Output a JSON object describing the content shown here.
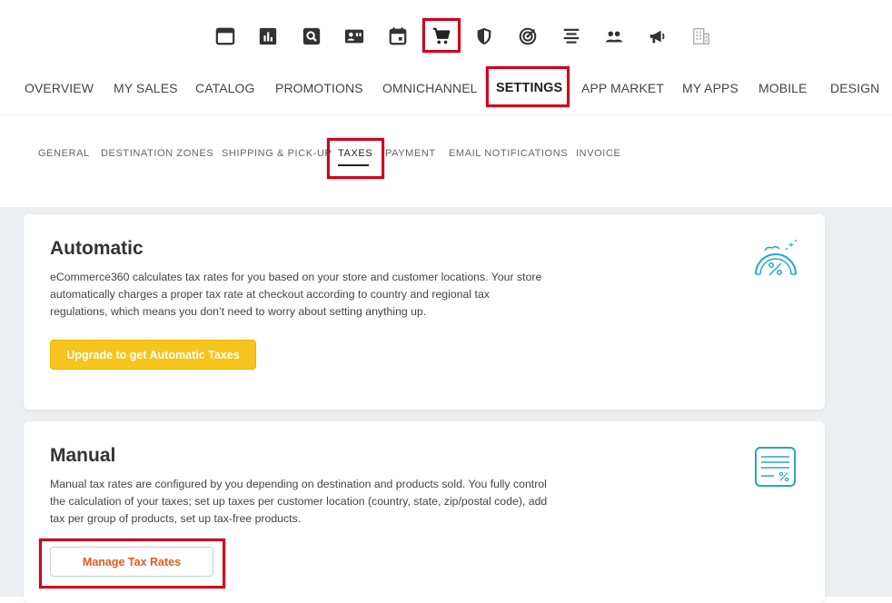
{
  "icons": [
    {
      "name": "browser-window-icon"
    },
    {
      "name": "bar-chart-icon"
    },
    {
      "name": "search-box-icon"
    },
    {
      "name": "contact-card-icon"
    },
    {
      "name": "calendar-icon"
    },
    {
      "name": "shopping-cart-icon"
    },
    {
      "name": "shield-icon"
    },
    {
      "name": "target-icon"
    },
    {
      "name": "align-center-icon"
    },
    {
      "name": "people-icon"
    },
    {
      "name": "megaphone-icon"
    },
    {
      "name": "building-icon"
    }
  ],
  "main_nav": [
    "OVERVIEW",
    "MY SALES",
    "CATALOG",
    "PROMOTIONS",
    "OMNICHANNEL",
    "SETTINGS",
    "APP MARKET",
    "MY APPS",
    "MOBILE",
    "DESIGN"
  ],
  "main_nav_active": "SETTINGS",
  "sub_nav": [
    "GENERAL",
    "DESTINATION ZONES",
    "SHIPPING & PICK-UP",
    "TAXES",
    "PAYMENT",
    "EMAIL NOTIFICATIONS",
    "INVOICE"
  ],
  "sub_nav_active": "TAXES",
  "automatic": {
    "title": "Automatic",
    "description": "eCommerce360 calculates tax rates for you based on your store and customer locations. Your store automatically charges a proper tax rate at checkout according to country and regional tax regulations, which means you don’t need to worry about setting anything up.",
    "button": "Upgrade to get Automatic Taxes",
    "icon": "percent-gauge-icon"
  },
  "manual": {
    "title": "Manual",
    "description": "Manual tax rates are configured by you depending on destination and products sold. You fully control the calculation of your taxes; set up taxes per customer location (country, state, zip/postal code), add tax per group of products, set up tax-free products.",
    "button": "Manage Tax Rates",
    "icon": "tax-document-icon"
  },
  "colors": {
    "highlight": "#d0021b",
    "accent_yellow": "#f7c31d",
    "accent_orange": "#e65a1e",
    "icon_teal": "#2aa6c8"
  }
}
